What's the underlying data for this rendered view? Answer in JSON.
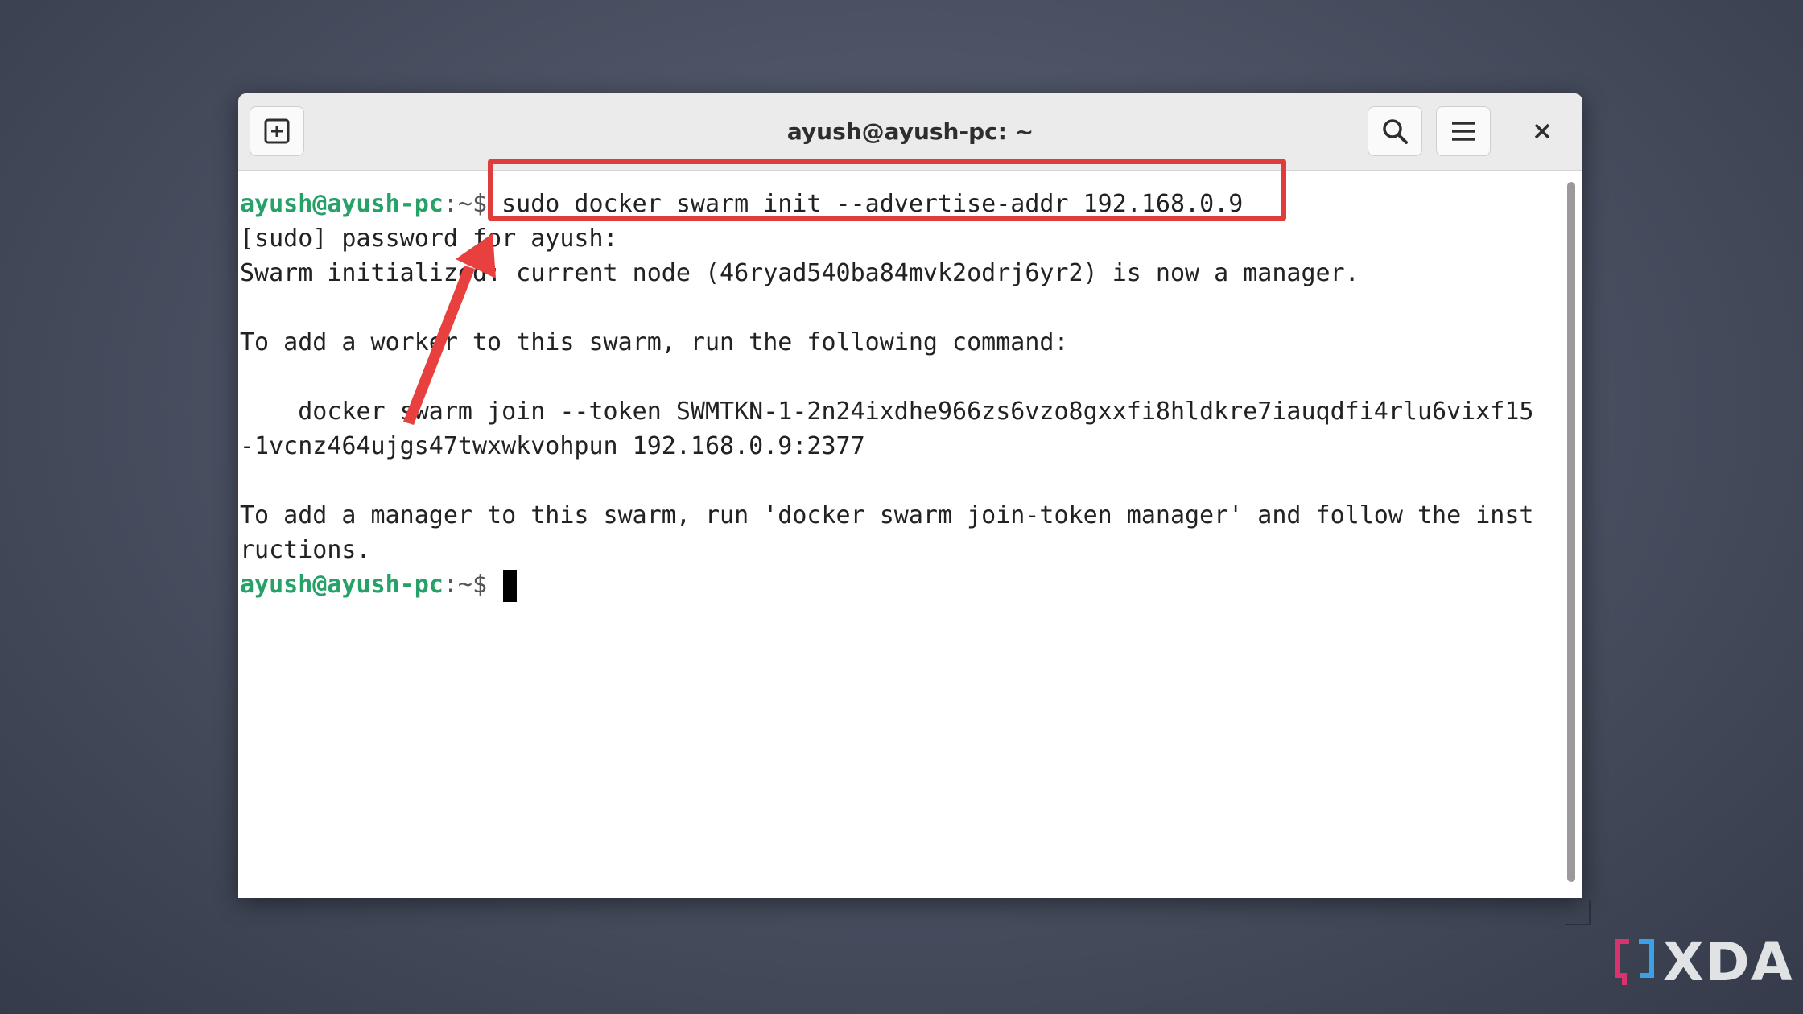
{
  "window": {
    "title": "ayush@ayush-pc: ~"
  },
  "icons": {
    "new_tab": "plus-square-icon",
    "search": "search-icon",
    "menu": "hamburger-menu-icon",
    "close": "close-icon"
  },
  "colors": {
    "prompt_user": "#26a269",
    "highlight": "#e03c3c",
    "arrow": "#e83f3f"
  },
  "terminal": {
    "prompt_user": "ayush@ayush-pc",
    "prompt_path": ":~$",
    "command": " sudo docker swarm init --advertise-addr 192.168.0.9",
    "lines": [
      "[sudo] password for ayush:",
      "Swarm initialized: current node (46ryad540ba84mvk2odrj6yr2) is now a manager.",
      "",
      "To add a worker to this swarm, run the following command:",
      "",
      "    docker swarm join --token SWMTKN-1-2n24ixdhe966zs6vzo8gxxfi8hldkre7iauqdfi4rlu6vixf15",
      "-1vcnz464ujgs47twxwkvohpun 192.168.0.9:2377",
      "",
      "To add a manager to this swarm, run 'docker swarm join-token manager' and follow the inst",
      "ructions."
    ],
    "final_prompt_user": "ayush@ayush-pc",
    "final_prompt_path": ":~$"
  },
  "watermark": {
    "text": "XDA"
  }
}
